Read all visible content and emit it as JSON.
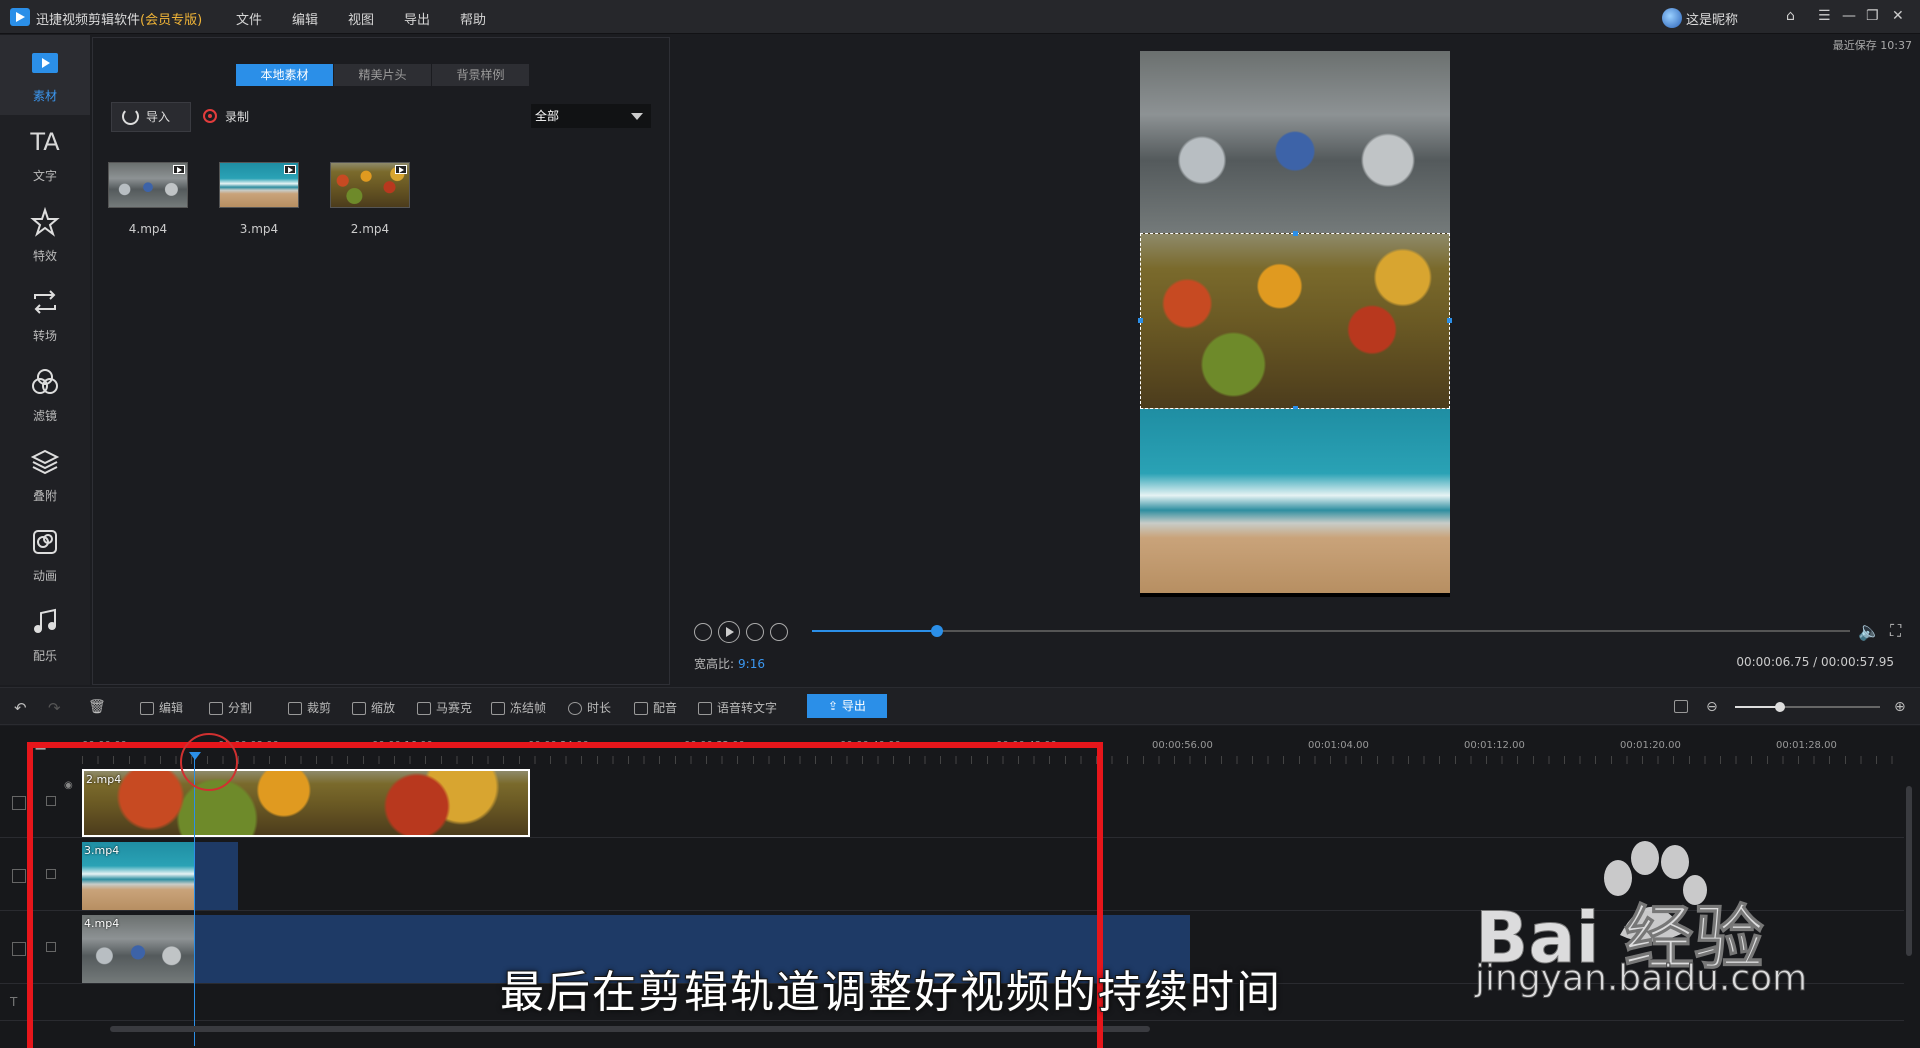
{
  "titlebar": {
    "app_name": "迅捷视频剪辑软件",
    "vip": "(会员专版)",
    "menu": [
      "文件",
      "编辑",
      "视图",
      "导出",
      "帮助"
    ],
    "user": "这是昵称"
  },
  "sidebar": {
    "items": [
      {
        "label": "素材",
        "icon": "media-icon"
      },
      {
        "label": "文字",
        "icon": "text-icon",
        "glyph": "TA"
      },
      {
        "label": "特效",
        "icon": "effects-icon"
      },
      {
        "label": "转场",
        "icon": "transition-icon"
      },
      {
        "label": "滤镜",
        "icon": "filter-icon"
      },
      {
        "label": "叠附",
        "icon": "overlay-icon"
      },
      {
        "label": "动画",
        "icon": "animation-icon"
      },
      {
        "label": "配乐",
        "icon": "music-icon"
      }
    ]
  },
  "media": {
    "tabs": [
      "本地素材",
      "精美片头",
      "背景样例"
    ],
    "import_label": "导入",
    "record_label": "录制",
    "filter_value": "全部",
    "files": [
      "4.mp4",
      "3.mp4",
      "2.mp4"
    ]
  },
  "preview": {
    "last_save": "最近保存 10:37",
    "ratio_label": "宽高比:",
    "ratio_value": "9:16",
    "time": "00:00:06.75 / 00:00:57.95",
    "progress": 0.12
  },
  "toolbar": {
    "items": [
      "编辑",
      "分割",
      "裁剪",
      "缩放",
      "马赛克",
      "冻结帧",
      "时长",
      "配音",
      "语音转文字"
    ],
    "export_label": "导出"
  },
  "timeline": {
    "ticks": [
      "00:00:00",
      "00:00:08.00",
      "00:00:16.00",
      "00:00:24.00",
      "00:00:32.00",
      "00:00:40.00",
      "00:00:48.00",
      "00:00:56.00",
      "00:01:04.00",
      "00:01:12.00",
      "00:01:20.00",
      "00:01:28.00"
    ],
    "clips": [
      "2.mp4",
      "3.mp4",
      "4.mp4"
    ]
  },
  "overlay": {
    "caption": "最后在剪辑轨道调整好视频的持续时间",
    "watermark_word": "Bai  经验",
    "watermark_url": "jingyan.baidu.com"
  }
}
